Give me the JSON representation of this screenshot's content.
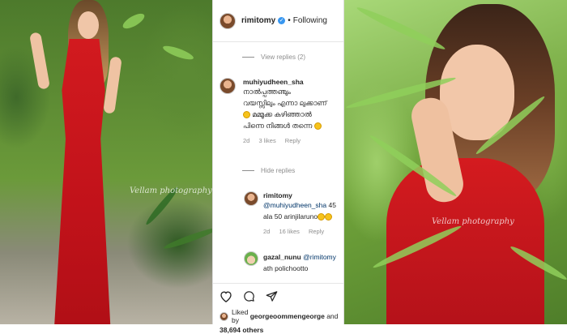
{
  "post": {
    "username": "rimitomy",
    "separator": "•",
    "follow_label": "Following"
  },
  "comments": {
    "view_replies_label": "View replies (2)",
    "first": {
      "username": "muhiyudheen_sha",
      "line1": "നാൽപ്പത്തഞ്ചും",
      "line2": "വയസ്സിലും എന്നാ ലുക്കാണ്",
      "line3": "മമ്മൂക്ക കഴിഞ്ഞാൽ",
      "line4": "പിന്നെ നിങ്ങൾ തന്നെ",
      "age": "2d",
      "likes": "3 likes",
      "reply_label": "Reply"
    },
    "hide_replies_label": "Hide replies",
    "reply1": {
      "username": "rimitomy",
      "mention": "@muhiyudheen_sha",
      "text_a": "45",
      "text_b": "ala 50 arinjilaruno",
      "age": "2d",
      "likes": "16 likes",
      "reply_label": "Reply"
    },
    "reply2": {
      "username": "gazal_nunu",
      "mention": "@rimitomy",
      "text_b": "ath polichootto"
    }
  },
  "footer": {
    "liked_by_prefix": "Liked by",
    "liked_by_user": "georgeoommengeorge",
    "and_label": "and",
    "others": "38,694 others"
  },
  "photos": {
    "left_watermark": "Vellam photography",
    "right_watermark": "Vellam photography"
  },
  "colors": {
    "verified": "#3897f0",
    "dress": "#d21a1f",
    "muted_text": "#8e8e8e"
  },
  "icons": [
    "heart-icon",
    "comment-icon",
    "share-icon",
    "verified-badge-icon"
  ]
}
